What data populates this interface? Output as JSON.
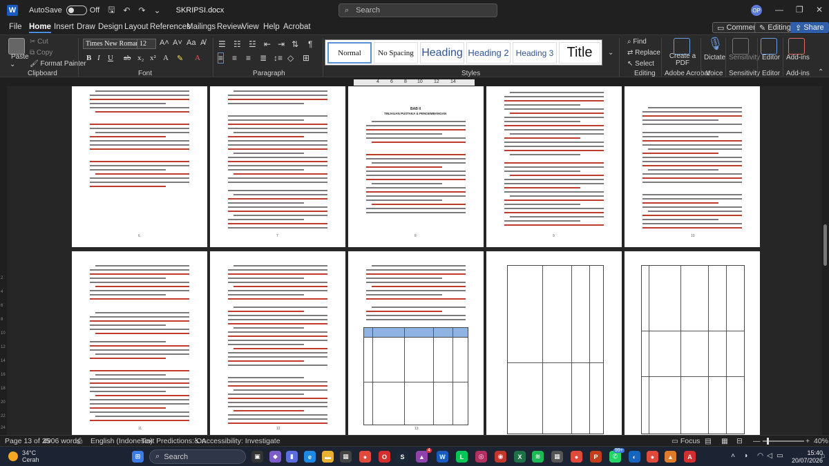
{
  "titlebar": {
    "app_icon": "word-icon",
    "autosave_label": "AutoSave",
    "autosave_state": "Off",
    "document_name": "SKRIPSI.docx",
    "search_placeholder": "Search",
    "user_initials": "OP"
  },
  "menu": {
    "items": [
      "File",
      "Home",
      "Insert",
      "Draw",
      "Design",
      "Layout",
      "References",
      "Mailings",
      "Review",
      "View",
      "Help",
      "Acrobat"
    ],
    "active": "Home",
    "comments_label": "Comments",
    "editing_label": "Editing",
    "share_label": "Share"
  },
  "ribbon": {
    "clipboard": {
      "paste": "Paste",
      "cut": "Cut",
      "copy": "Copy",
      "format_painter": "Format Painter",
      "group": "Clipboard"
    },
    "font": {
      "family": "Times New Roman",
      "size": "12",
      "group": "Font",
      "buttons": [
        "B",
        "I",
        "U",
        "ab",
        "x₂",
        "x²",
        "A"
      ]
    },
    "paragraph": {
      "group": "Paragraph"
    },
    "styles": {
      "group": "Styles",
      "items": [
        "Normal",
        "No Spacing",
        "Heading",
        "Heading 2",
        "Heading 3",
        "Title"
      ]
    },
    "editing": {
      "find": "Find",
      "replace": "Replace",
      "select": "Select",
      "group": "Editing"
    },
    "acrobat": {
      "create_pdf": "Create a PDF",
      "group": "Adobe Acrobat"
    },
    "voice": {
      "dictate": "Dictate",
      "group": "Voice"
    },
    "sensitivity": {
      "label": "Sensitivity",
      "group": "Sensitivity"
    },
    "editor": {
      "label": "Editor",
      "group": "Editor"
    },
    "addins": {
      "label": "Add-ins",
      "group": "Add-ins"
    }
  },
  "ruler": {
    "numbers": [
      "4",
      "6",
      "8",
      "10",
      "12",
      "14"
    ]
  },
  "vertical_ruler": {
    "numbers": [
      "2",
      "4",
      "6",
      "8",
      "10",
      "12",
      "14",
      "16",
      "18",
      "20",
      "22",
      "24"
    ]
  },
  "pages": {
    "numbers_row1": [
      "6",
      "7",
      "8",
      "9",
      "10"
    ],
    "numbers_row2": [
      "11",
      "12",
      "13",
      "14",
      "15"
    ],
    "page7_heading": "BAB II",
    "page7_subheading": "TINJAUAN PUSTAKA & PENGEMBANGAN"
  },
  "status": {
    "page": "Page 13 of 25",
    "words": "4906 words",
    "language": "English (Indonesia)",
    "predictions": "Text Predictions: On",
    "accessibility": "Accessibility: Investigate",
    "focus": "Focus",
    "zoom": "40%"
  },
  "taskbar": {
    "temperature": "34°C",
    "weather": "Cerah",
    "search_placeholder": "Search",
    "badge_count": "4",
    "badge_count_2": "99+",
    "time": "15:40",
    "date": "20/07/2026"
  }
}
